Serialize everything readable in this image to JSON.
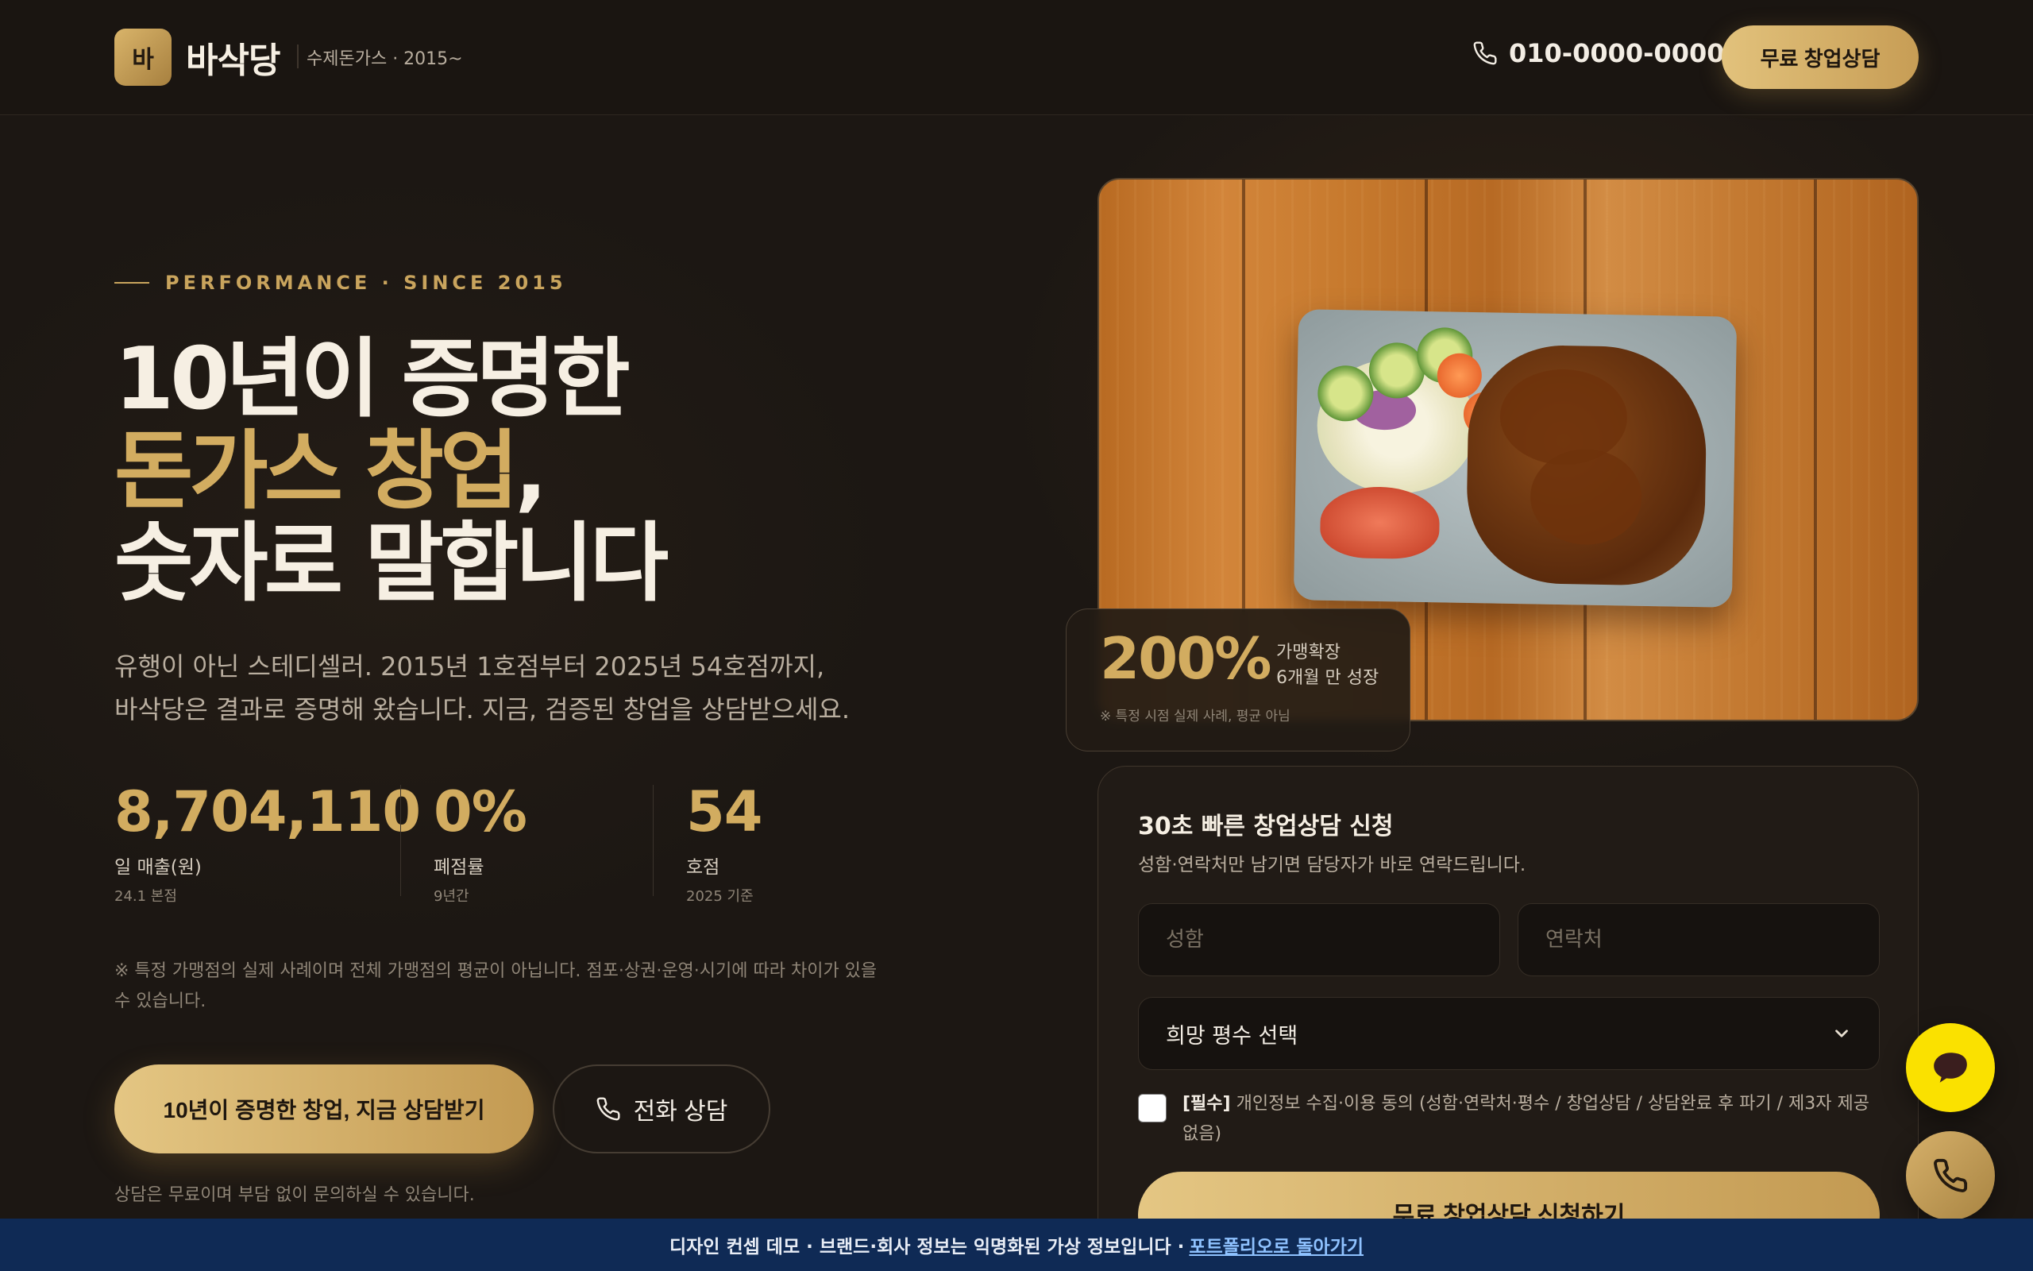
{
  "header": {
    "logo_mark": "바",
    "brand": "바삭당",
    "tagline": "수제돈가스 · 2015~",
    "phone": "010-0000-0000",
    "cta": "무료 창업상담"
  },
  "hero": {
    "eyebrow": "PERFORMANCE · SINCE 2015",
    "title_line1": "10년이 증명한",
    "title_line2_gold": "돈가스 창업",
    "title_line2_tail": ",",
    "title_line3": "숫자로 말합니다",
    "lead_line1": "유행이 아닌 스테디셀러. 2015년 1호점부터 2025년 54호점까지,",
    "lead_line2": "바삭당은 결과로 증명해 왔습니다. 지금, 검증된 창업을 상담받으세요.",
    "stats": [
      {
        "value": "8,704,110",
        "label": "일 매출(원)",
        "sub": "24.1 본점"
      },
      {
        "value": "0%",
        "label": "폐점률",
        "sub": "9년간"
      },
      {
        "value": "54",
        "label": "호점",
        "sub": "2025 기준"
      }
    ],
    "disclaimer": "※ 특정 가맹점의 실제 사례이며 전체 가맹점의 평균이 아닙니다. 점포·상권·운영·시기에 따라 차이가 있을 수 있습니다.",
    "primary_cta": "10년이 증명한 창업, 지금 상담받기",
    "secondary_cta": "전화 상담",
    "note": "상담은 무료이며 부담 없이 문의하실 수 있습니다."
  },
  "badge": {
    "value": "200%",
    "line1": "가맹확장",
    "line2": "6개월 만 성장",
    "fine": "※ 특정 시점 실제 사례, 평균 아님"
  },
  "form": {
    "title": "30초 빠른 창업상담 신청",
    "subtitle": "성함·연락처만 남기면 담당자가 바로 연락드립니다.",
    "name_placeholder": "성함",
    "phone_placeholder": "연락처",
    "select_value": "희망 평수 선택",
    "consent_required": "[필수]",
    "consent_text": "개인정보 수집·이용 동의 (성함·연락처·평수 / 창업상담 / 상담완료 후 파기 / 제3자 제공 없음)",
    "submit": "무료 창업상담 신청하기"
  },
  "banner": {
    "text": "디자인 컨셉 데모 · 브랜드·회사 정보는 익명화된 가상 정보입니다 ·",
    "link": "포트폴리오로 돌아가기"
  },
  "colors": {
    "background": "#1c1713",
    "gold": "#d2ac60",
    "banner": "#0f2a55",
    "kakao": "#fae100"
  }
}
